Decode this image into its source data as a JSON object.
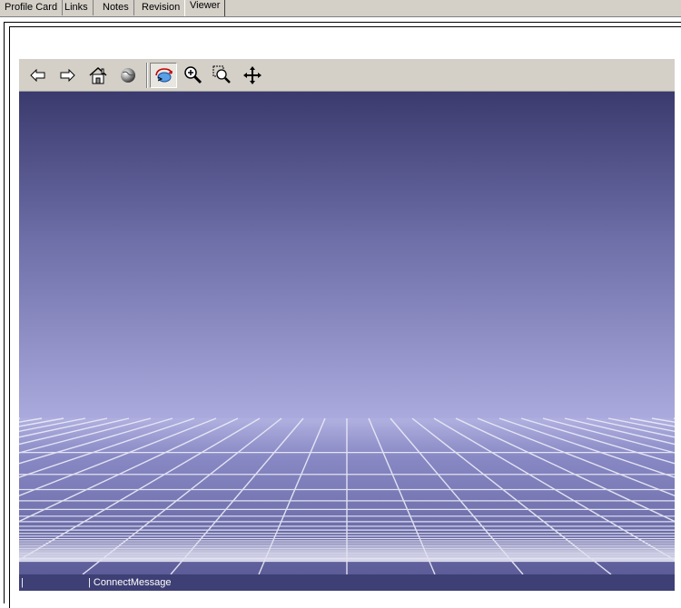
{
  "tabs": [
    {
      "label": "Profile Card",
      "active": false
    },
    {
      "label": "Links",
      "active": false
    },
    {
      "label": "Notes",
      "active": false
    },
    {
      "label": "Revision",
      "active": false
    },
    {
      "label": "Viewer",
      "active": true
    }
  ],
  "toolbar": {
    "buttons": [
      {
        "icon": "back-arrow-icon"
      },
      {
        "icon": "forward-arrow-icon"
      },
      {
        "icon": "home-icon"
      },
      {
        "icon": "globe-icon"
      },
      {
        "icon": "orbit-rotate-icon",
        "pressed": true
      },
      {
        "icon": "zoom-in-icon"
      },
      {
        "icon": "zoom-box-icon"
      },
      {
        "icon": "pan-icon"
      }
    ]
  },
  "scene": {
    "sky_top": "#3c3c70",
    "horizon": "#aaaade",
    "floor": "#6a6aa6",
    "grid_color": "#e6e6f5"
  },
  "status": {
    "left": "|",
    "message": "| ConnectMessage"
  }
}
